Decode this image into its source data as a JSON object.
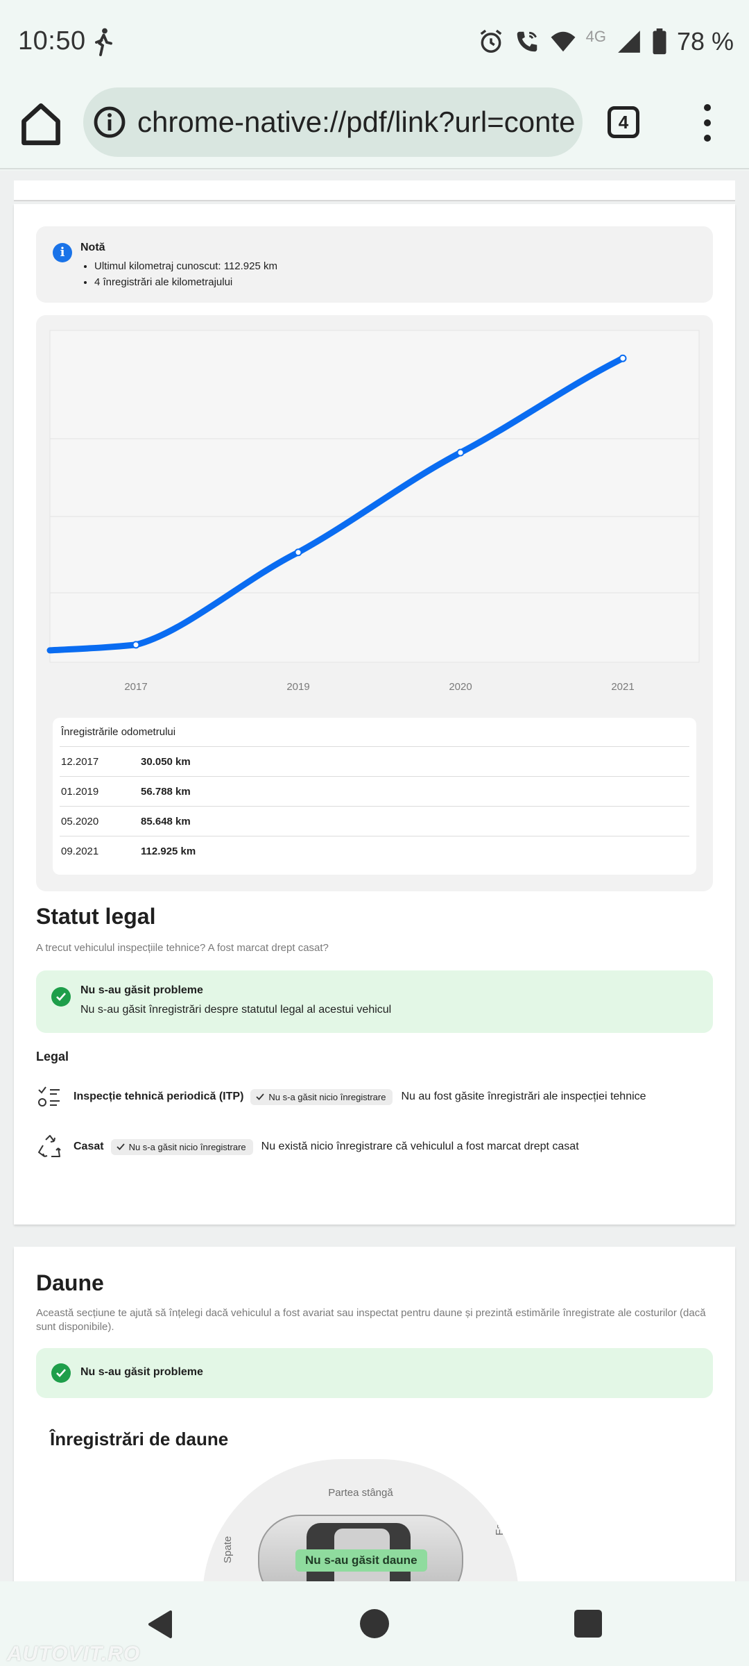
{
  "status_bar": {
    "time": "10:50",
    "network": "4G",
    "battery": "78 %",
    "icons": [
      "walking-icon",
      "alarm-icon",
      "wifi-call-icon",
      "wifi-icon",
      "signal-icon",
      "battery-icon"
    ]
  },
  "browser": {
    "url": "chrome-native://pdf/link?url=conte",
    "tab_count": "4"
  },
  "note": {
    "title": "Notă",
    "items": [
      "Ultimul kilometraj cunoscut: 112.925 km",
      "4 înregistrări ale kilometrajului"
    ]
  },
  "chart_data": {
    "type": "line",
    "x": [
      "2017",
      "2019",
      "2020",
      "2021"
    ],
    "series": [
      {
        "values": [
          30050,
          56788,
          85648,
          112925
        ]
      }
    ],
    "line_color": "#0a6cf1",
    "grid": true
  },
  "odometer": {
    "title": "Înregistrările odometrului",
    "rows": [
      {
        "date": "12.2017",
        "value": "30.050 km"
      },
      {
        "date": "01.2019",
        "value": "56.788 km"
      },
      {
        "date": "05.2020",
        "value": "85.648 km"
      },
      {
        "date": "09.2021",
        "value": "112.925 km"
      }
    ]
  },
  "legal_status": {
    "title": "Statut legal",
    "subtitle": "A trecut vehiculul inspecțiile tehnice? A fost marcat drept casat?",
    "ok_title": "Nu s-au găsit probleme",
    "ok_desc": "Nu s-au găsit înregistrări despre statutul legal al acestui vehicul",
    "legal_heading": "Legal",
    "items": [
      {
        "name": "Inspecție tehnică periodică (ITP)",
        "chip": "Nu s-a găsit nicio înregistrare",
        "desc": "Nu au fost găsite înregistrări ale inspecției tehnice"
      },
      {
        "name": "Casat",
        "chip": "Nu s-a găsit nicio înregistrare",
        "desc": "Nu există nicio înregistrare că vehiculul a fost marcat drept casat"
      }
    ]
  },
  "damage": {
    "title": "Daune",
    "subtitle": "Această secțiune te ajută să înțelegi dacă vehiculul a fost avariat sau inspectat pentru daune și prezintă estimările înregistrate ale costurilor (dacă sunt disponibile).",
    "ok_title": "Nu s-au găsit probleme",
    "records_title": "Înregistrări de daune",
    "side_top": "Partea stângă",
    "side_left": "Spate",
    "side_right": "Față",
    "badge": "Nu s-au găsit daune"
  },
  "colors": {
    "accent_blue": "#1a73e8",
    "success_bg": "#e3f7e6",
    "success_icon": "#1e9e4a"
  },
  "watermark": "AUTOVIT.RO"
}
